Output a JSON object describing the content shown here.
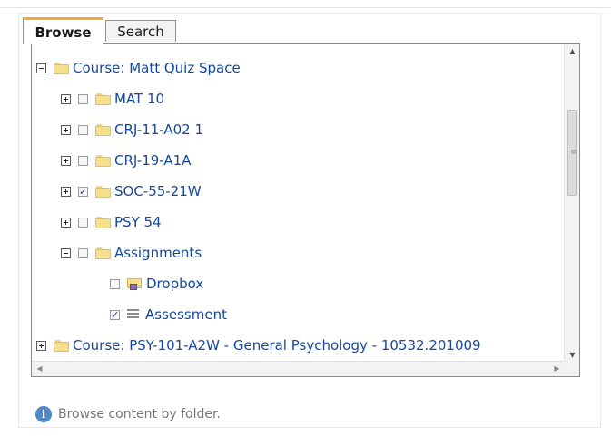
{
  "tabs": [
    {
      "label": "Browse"
    },
    {
      "label": "Search"
    }
  ],
  "tree": [
    {
      "label": "Course: Matt Quiz Space",
      "expander": "minus",
      "checkbox": null,
      "icon": "folder-icon"
    },
    {
      "label": "MAT 10",
      "expander": "plus",
      "checkbox": "unchecked",
      "icon": "folder-icon"
    },
    {
      "label": "CRJ-11-A02 1",
      "expander": "plus",
      "checkbox": "unchecked",
      "icon": "folder-icon"
    },
    {
      "label": "CRJ-19-A1A",
      "expander": "plus",
      "checkbox": "unchecked",
      "icon": "folder-icon"
    },
    {
      "label": "SOC-55-21W",
      "expander": "plus",
      "checkbox": "checked",
      "icon": "folder-icon"
    },
    {
      "label": "PSY 54",
      "expander": "plus",
      "checkbox": "unchecked",
      "icon": "folder-icon"
    },
    {
      "label": "Assignments",
      "expander": "minus",
      "checkbox": "unchecked",
      "icon": "folder-icon"
    },
    {
      "label": "Dropbox",
      "expander": null,
      "checkbox": "unchecked",
      "icon": "dropbox-icon"
    },
    {
      "label": "Assessment",
      "expander": null,
      "checkbox": "checked",
      "icon": "assessment-icon"
    },
    {
      "label": "Course: PSY-101-A2W - General Psychology - 10532.201009",
      "expander": "plus",
      "checkbox": null,
      "icon": "folder-icon"
    }
  ],
  "footer": {
    "text": "Browse content by folder.",
    "icon": "info-icon"
  },
  "colors": {
    "link": "#14489c",
    "active_tab_accent": "#f2a73f",
    "folder": "#f7e08d"
  }
}
